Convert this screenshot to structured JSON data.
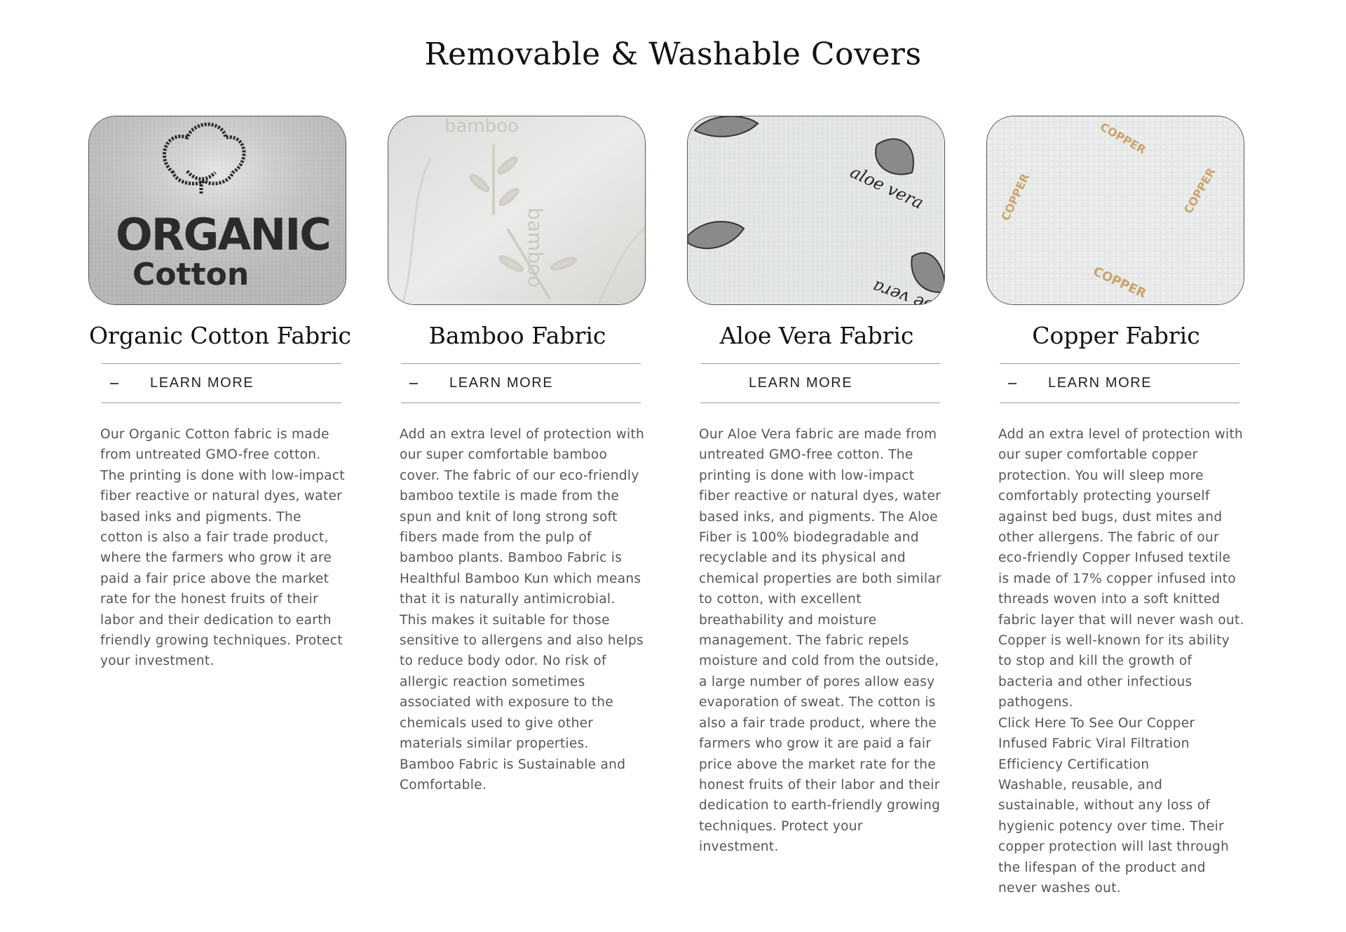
{
  "page": {
    "title": "Removable & Washable Covers"
  },
  "cards": [
    {
      "image_text": [
        "ORGANIC",
        "Cotton"
      ],
      "title": "Organic Cotton Fabric",
      "learn_more": "LEARN MORE",
      "toggle_icon": "minus-icon",
      "description": [
        "Our Organic Cotton fabric is made from untreated GMO-free cotton. The printing is done with low-impact fiber reactive or natural dyes, water based inks and pigments. The cotton is also a fair trade product, where the farmers who grow it are paid a fair price above the market rate for the honest fruits of their labor and their dedication to earth friendly growing techniques. Protect your investment."
      ]
    },
    {
      "image_text": [
        "bamboo",
        "bamboo"
      ],
      "title": "Bamboo Fabric",
      "learn_more": "LEARN MORE",
      "toggle_icon": "minus-icon",
      "description": [
        "Add an extra level of protection with our super comfortable bamboo cover. The fabric of our eco-friendly bamboo textile is made from the spun and knit of long strong soft fibers made from the pulp of bamboo plants. Bamboo Fabric is Healthful Bamboo Kun which means that it is naturally antimicrobial. This makes it suitable for those sensitive to allergens and also helps to reduce body odor. No risk of allergic reaction sometimes associated with exposure to the chemicals used to give other materials similar properties. Bamboo Fabric is Sustainable and Comfortable."
      ]
    },
    {
      "image_text": [
        "aloe vera",
        "aloe vera"
      ],
      "title": "Aloe Vera Fabric",
      "learn_more": "LEARN MORE",
      "toggle_icon": "",
      "description": [
        "Our Aloe Vera fabric are made from untreated GMO-free cotton. The printing is done with low-impact fiber reactive or natural dyes, water based inks, and pigments. The Aloe Fiber is 100% biodegradable and recyclable and its physical and chemical properties are both similar to cotton, with excellent breathability and moisture management. The fabric repels moisture and cold from the outside, a large number of pores allow easy evaporation of sweat. The cotton is also a fair trade product, where the farmers who grow it are paid a fair price above the market rate for the honest fruits of their labor and their dedication to earth-friendly growing techniques. Protect your investment."
      ]
    },
    {
      "image_text": [
        "COPPER",
        "COPPER",
        "COPPER",
        "COPPER"
      ],
      "title": "Copper Fabric",
      "learn_more": "LEARN MORE",
      "toggle_icon": "minus-icon",
      "description": [
        "Add an extra level of protection with our super comfortable copper protection. You will sleep more comfortably protecting yourself against bed bugs, dust mites and other allergens. The fabric of our eco-friendly Copper Infused textile is made of 17% copper infused into threads woven into a soft knitted fabric layer that will never wash out. Copper is well-known for its ability to stop and kill the growth of bacteria and other infectious pathogens.",
        "Click Here To See Our Copper Infused Fabric Viral Filtration Efficiency Certification",
        "Washable, reusable, and sustainable, without any loss of hygienic potency over time. Their copper protection will last through the lifespan of the product and never washes out."
      ]
    }
  ],
  "colors": {
    "heading": "#111111",
    "body_text": "#555555",
    "divider": "#9a9a9a",
    "copper_print": "#c8a56a",
    "aloe_leaf": "#7a7a7a"
  }
}
